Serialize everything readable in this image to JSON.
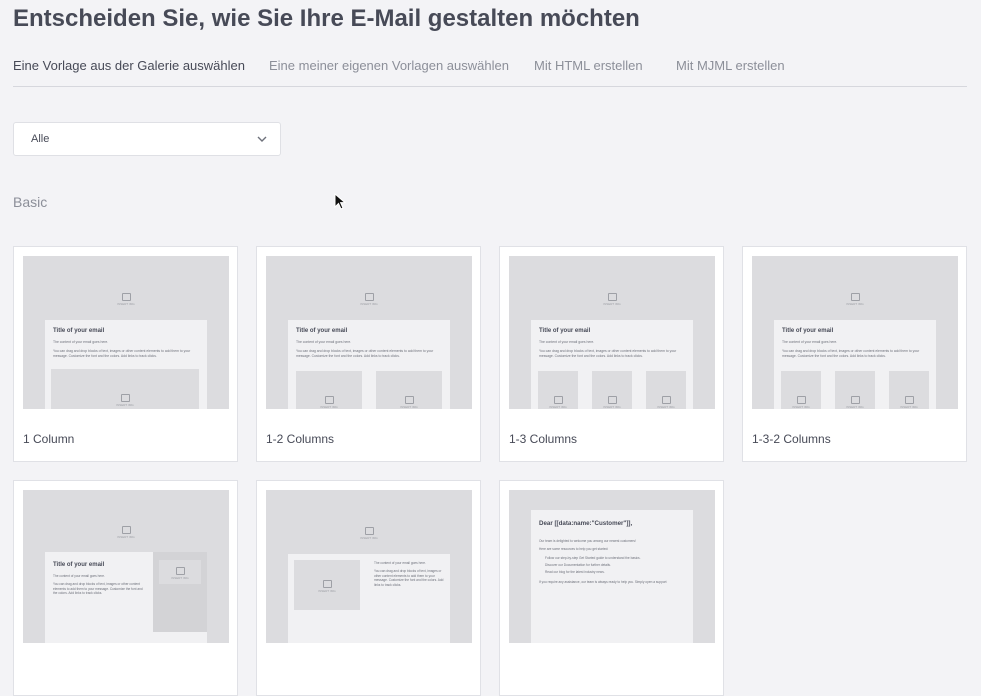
{
  "page": {
    "title": "Entscheiden Sie, wie Sie Ihre E-Mail gestalten möchten"
  },
  "tabs": [
    {
      "label": "Eine Vorlage aus der Galerie auswählen",
      "active": true
    },
    {
      "label": "Eine meiner eigenen Vorlagen auswählen"
    },
    {
      "label": "Mit HTML erstellen"
    },
    {
      "label": "Mit MJML erstellen"
    }
  ],
  "filter": {
    "value": "Alle",
    "icon": "chevron-down-icon"
  },
  "section": {
    "label": "Basic"
  },
  "preview": {
    "title": "Title of your email",
    "content_line": "The content of your email goes here.",
    "body_text": "You can drag and drop blocks of text, images or other content elements to add them to your message. Customize the font and the colors. Add links to track clicks.",
    "image_placeholder": "INSERT IMG",
    "greeting": "Dear [[data:name:\"Customer\"]],",
    "welcome": "Our team is delighted to welcome you among our newest customers!",
    "resources_intro": "Here are some resources to help you get started:",
    "bullets": [
      "Follow our step-by-step Get Started guide to understand the basics.",
      "Discover our Documentation for further details.",
      "Read our blog for the latest industry news."
    ],
    "help": "If you require any assistance, our team is always ready to help you. Simply open a support"
  },
  "templates": [
    {
      "name": "1 Column"
    },
    {
      "name": "1-2 Columns"
    },
    {
      "name": "1-3 Columns"
    },
    {
      "name": "1-3-2 Columns"
    },
    {
      "name": ""
    },
    {
      "name": ""
    },
    {
      "name": ""
    }
  ],
  "colors": {
    "background": "#f3f3f6",
    "card": "#ffffff",
    "placeholder": "#dcdcdf",
    "text": "#474a57",
    "muted": "#8c8f99"
  }
}
